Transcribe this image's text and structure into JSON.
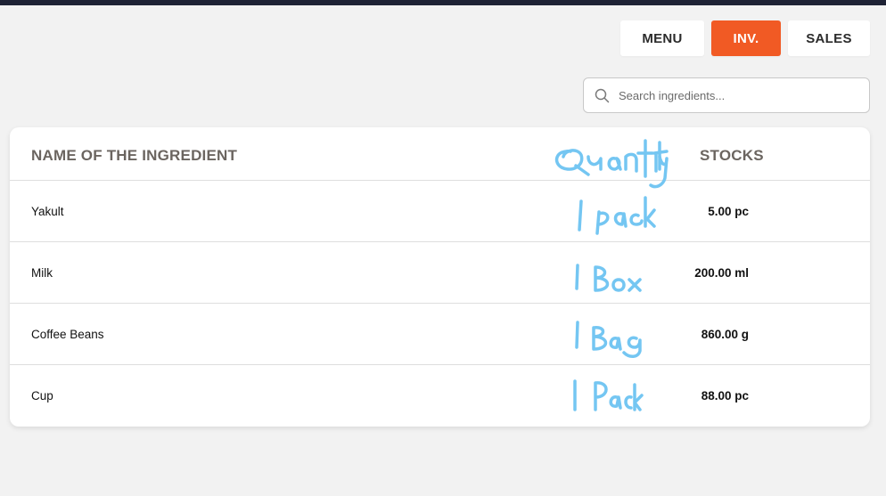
{
  "nav": {
    "menu_label": "MENU",
    "inv_label": "INV.",
    "sales_label": "SALES",
    "active": "INV."
  },
  "search": {
    "placeholder": "Search ingredients...",
    "value": ""
  },
  "table": {
    "columns": {
      "name": "NAME OF THE INGREDIENT",
      "stocks": "STOCKS"
    },
    "rows": [
      {
        "name": "Yakult",
        "stock": "5.00 pc"
      },
      {
        "name": "Milk",
        "stock": "200.00 ml"
      },
      {
        "name": "Coffee Beans",
        "stock": "860.00 g"
      },
      {
        "name": "Cup",
        "stock": "88.00 pc"
      }
    ]
  },
  "handwriting": {
    "column_header": "Quantity",
    "rows": [
      "1 pack",
      "1 Box",
      "1 Bag",
      "1 Pack"
    ]
  },
  "colors": {
    "accent": "#f15a24",
    "ink": "#74c6f2",
    "topbar": "#1e2235"
  }
}
